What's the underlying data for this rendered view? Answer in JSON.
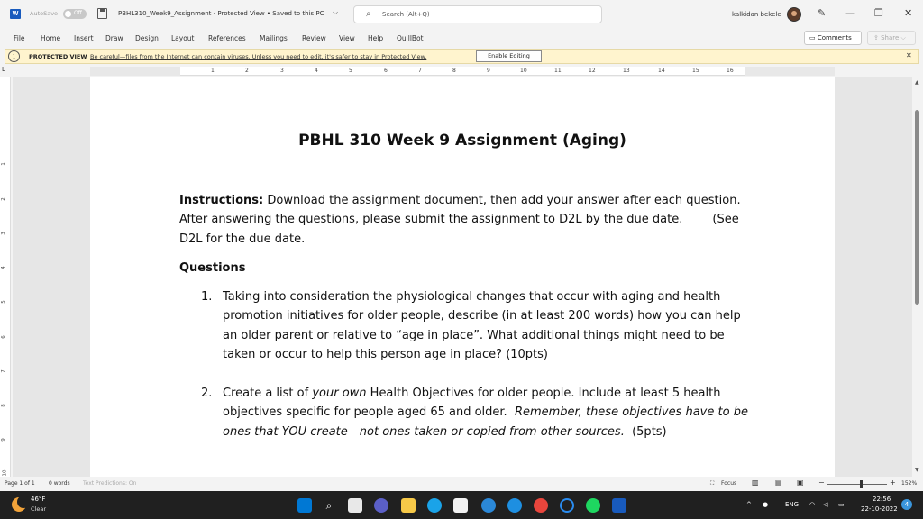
{
  "window": {
    "autosave_label": "AutoSave",
    "autosave_state": "Off",
    "doc_title": "PBHL310_Week9_Assignment  -  Protected View • Saved to this PC",
    "search_placeholder": "Search (Alt+Q)",
    "user_name": "kalkidan bekele",
    "minimize": "—",
    "restore": "❐",
    "close": "✕"
  },
  "ribbon": {
    "tabs": [
      "File",
      "Home",
      "Insert",
      "Draw",
      "Design",
      "Layout",
      "References",
      "Mailings",
      "Review",
      "View",
      "Help",
      "QuillBot"
    ],
    "comments_label": "Comments",
    "share_label": "Share"
  },
  "protected_view": {
    "label": "PROTECTED VIEW",
    "message": "Be careful—files from the Internet can contain viruses. Unless you need to edit, it's safer to stay in Protected View.",
    "enable_label": "Enable Editing",
    "close": "✕"
  },
  "ruler": {
    "h_ticks": [
      "1",
      "2",
      "3",
      "4",
      "5",
      "6",
      "7",
      "8",
      "9",
      "10",
      "11",
      "12",
      "13",
      "14",
      "15",
      "16"
    ],
    "v_ticks": [
      "1",
      "2",
      "3",
      "4",
      "5",
      "6",
      "7",
      "8",
      "9",
      "10"
    ]
  },
  "document": {
    "heading": "PBHL 310  Week 9 Assignment (Aging)",
    "instructions_label": "Instructions:",
    "instructions_line1": " Download the assignment document, then add your answer after each question.",
    "instructions_line2": "After answering the questions, please submit the assignment to D2L by the due date.        (See",
    "instructions_line3": "D2L for the due date.",
    "questions_heading": "Questions",
    "questions": [
      {
        "num": "1.",
        "lines": [
          "Taking into consideration the physiological changes that occur with aging and health",
          "promotion initiatives for older people, describe (in at least 200 words) how you can help",
          "an older parent or relative to “age in place”.  What additional things might need to be",
          "taken or occur to help this person age in place? (10pts)"
        ]
      },
      {
        "num": "2.",
        "line1_pre": "Create a list of ",
        "line1_em": "your own",
        "line1_post": " Health Objectives for older people.  Include at least 5 health",
        "line2_pre": "objectives specific for people aged 65 and older.  ",
        "line2_em": "Remember, these objectives have to be",
        "line3_em": "ones that YOU create—not ones taken or copied from other sources.",
        "line3_post": "  (5pts)"
      }
    ]
  },
  "statusbar": {
    "page": "Page 1 of 1",
    "words": "0 words",
    "predictions": "Text Predictions: On",
    "focus": "Focus",
    "zoom": "152%"
  },
  "taskbar": {
    "temp": "46°F",
    "condition": "Clear",
    "lang": "ENG",
    "time": "22:56",
    "date": "22-10-2022",
    "notifications": "4"
  }
}
